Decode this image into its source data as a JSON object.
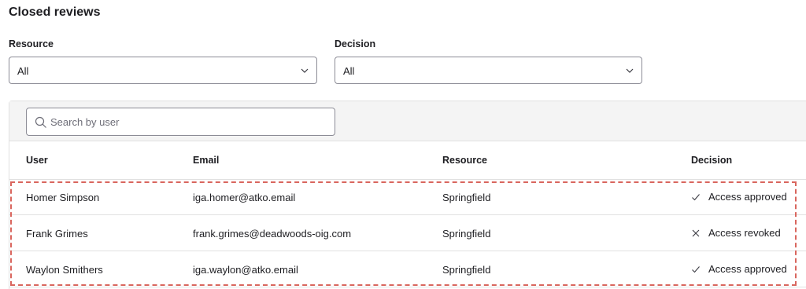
{
  "page": {
    "title": "Closed reviews"
  },
  "filters": {
    "resource": {
      "label": "Resource",
      "value": "All"
    },
    "decision": {
      "label": "Decision",
      "value": "All"
    }
  },
  "search": {
    "placeholder": "Search by user",
    "value": ""
  },
  "table": {
    "headers": {
      "user": "User",
      "email": "Email",
      "resource": "Resource",
      "decision": "Decision"
    },
    "rows": [
      {
        "user": "Homer Simpson",
        "email": "iga.homer@atko.email",
        "resource": "Springfield",
        "decision": "Access approved",
        "decision_icon": "check-icon"
      },
      {
        "user": "Frank Grimes",
        "email": "frank.grimes@deadwoods-oig.com",
        "resource": "Springfield",
        "decision": "Access revoked",
        "decision_icon": "x-icon"
      },
      {
        "user": "Waylon Smithers",
        "email": "iga.waylon@atko.email",
        "resource": "Springfield",
        "decision": "Access approved",
        "decision_icon": "check-icon"
      }
    ]
  },
  "colors": {
    "highlight_border": "#d9665e",
    "toolbar_bg": "#f4f4f4"
  }
}
